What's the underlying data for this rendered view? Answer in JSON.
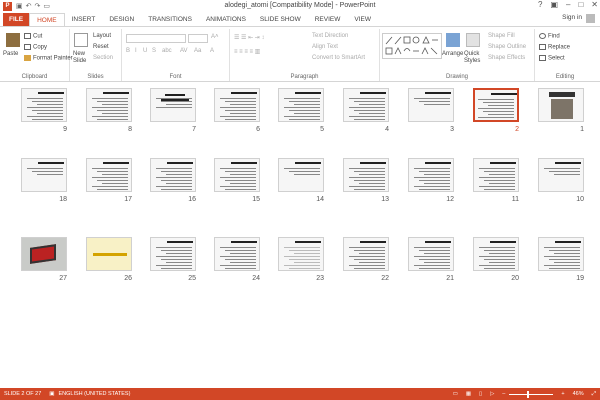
{
  "app": {
    "doc_title": "alodegi_atomi [Compatibility Mode] - PowerPoint",
    "sign_in": "Sign in"
  },
  "tabs": [
    "FILE",
    "HOME",
    "INSERT",
    "DESIGN",
    "TRANSITIONS",
    "ANIMATIONS",
    "SLIDE SHOW",
    "REVIEW",
    "VIEW"
  ],
  "ribbon": {
    "clipboard": {
      "label": "Clipboard",
      "paste": "Paste",
      "cut": "Cut",
      "copy": "Copy",
      "format_painter": "Format Painter"
    },
    "slides": {
      "label": "Slides",
      "new_slide": "New Slide",
      "layout": "Layout",
      "reset": "Reset",
      "section": "Section"
    },
    "font": {
      "label": "Font"
    },
    "paragraph": {
      "label": "Paragraph",
      "text_direction": "Text Direction",
      "align_text": "Align Text",
      "convert": "Convert to SmartArt"
    },
    "drawing": {
      "label": "Drawing",
      "arrange": "Arrange",
      "quick_styles": "Quick Styles",
      "shape_fill": "Shape Fill",
      "shape_outline": "Shape Outline",
      "shape_effects": "Shape Effects"
    },
    "editing": {
      "label": "Editing",
      "find": "Find",
      "replace": "Replace",
      "select": "Select"
    }
  },
  "slides": [
    {
      "n": 1,
      "kind": "image"
    },
    {
      "n": 2,
      "kind": "text",
      "selected": true
    },
    {
      "n": 3,
      "kind": "short"
    },
    {
      "n": 4,
      "kind": "text"
    },
    {
      "n": 5,
      "kind": "text"
    },
    {
      "n": 6,
      "kind": "text"
    },
    {
      "n": 7,
      "kind": "title"
    },
    {
      "n": 8,
      "kind": "text"
    },
    {
      "n": 9,
      "kind": "text"
    },
    {
      "n": 10,
      "kind": "short"
    },
    {
      "n": 11,
      "kind": "text"
    },
    {
      "n": 12,
      "kind": "text"
    },
    {
      "n": 13,
      "kind": "text"
    },
    {
      "n": 14,
      "kind": "short"
    },
    {
      "n": 15,
      "kind": "text"
    },
    {
      "n": 16,
      "kind": "text"
    },
    {
      "n": 17,
      "kind": "text"
    },
    {
      "n": 18,
      "kind": "short"
    },
    {
      "n": 19,
      "kind": "text"
    },
    {
      "n": 20,
      "kind": "text"
    },
    {
      "n": 21,
      "kind": "text"
    },
    {
      "n": 22,
      "kind": "text"
    },
    {
      "n": 23,
      "kind": "faint"
    },
    {
      "n": 24,
      "kind": "text"
    },
    {
      "n": 25,
      "kind": "text"
    },
    {
      "n": 26,
      "kind": "yellow"
    },
    {
      "n": 27,
      "kind": "laptop"
    }
  ],
  "status": {
    "slide_of": "SLIDE 2 OF 27",
    "language": "ENGLISH (UNITED STATES)",
    "zoom": "46%"
  },
  "colors": {
    "accent": "#d24726",
    "selected_border": "#d24726"
  }
}
